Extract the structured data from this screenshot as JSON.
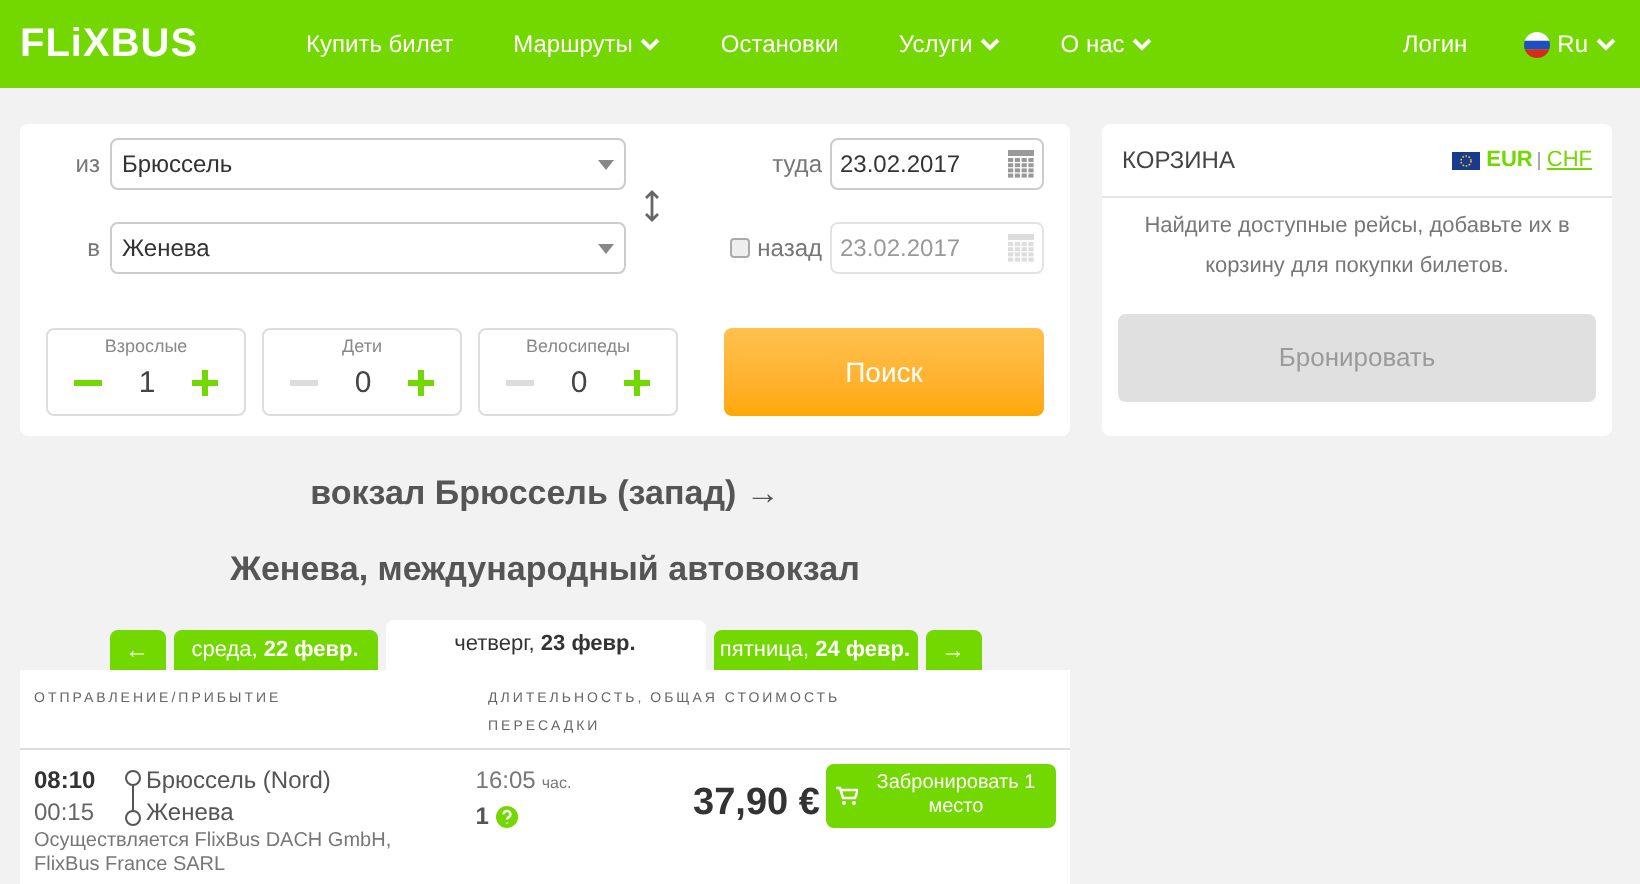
{
  "header": {
    "logo": "FLiXBUS",
    "nav": [
      {
        "label": "Купить билет",
        "dropdown": false
      },
      {
        "label": "Маршруты",
        "dropdown": true
      },
      {
        "label": "Остановки",
        "dropdown": false
      },
      {
        "label": "Услуги",
        "dropdown": true
      },
      {
        "label": "О нас",
        "dropdown": true
      }
    ],
    "login": "Логин",
    "language": "Ru"
  },
  "search": {
    "from": {
      "label": "из",
      "value": "Брюссель"
    },
    "to": {
      "label": "в",
      "value": "Женева"
    },
    "outbound": {
      "label": "туда",
      "value": "23.02.2017"
    },
    "return": {
      "label": "назад",
      "checked": false,
      "value": "23.02.2017"
    },
    "passengers": [
      {
        "label": "Взрослые",
        "value": "1",
        "decrement_disabled": false
      },
      {
        "label": "Дети",
        "value": "0",
        "decrement_disabled": true
      },
      {
        "label": "Велосипеды",
        "value": "0",
        "decrement_disabled": true
      }
    ],
    "button": "Поиск"
  },
  "cart": {
    "title": "КОРЗИНА",
    "currencies": [
      {
        "label": "EUR",
        "selected": true
      },
      {
        "label": "CHF",
        "selected": false
      }
    ],
    "message": "Найдите доступные рейсы, добавьте их в корзину для покупки билетов.",
    "button": "Бронировать",
    "button_disabled": true
  },
  "route_title": [
    "вокзал Брюссель (запад) →",
    "Женева, международный автовокзал"
  ],
  "date_tabs": {
    "prev": "←",
    "next": "→",
    "days": [
      {
        "weekday": "среда,",
        "date": "22 февр.",
        "selected": false
      },
      {
        "weekday": "четверг,",
        "date": "23 февр.",
        "selected": true
      },
      {
        "weekday": "пятница,",
        "date": "24 февр.",
        "selected": false
      }
    ]
  },
  "table": {
    "columns": [
      "ОТПРАВЛЕНИЕ/ПРИБЫТИЕ",
      "ДЛИТЕЛЬНОСТЬ,",
      "ОБЩАЯ СТОИМОСТЬ",
      "ПЕРЕСАДКИ"
    ],
    "rows": [
      {
        "departure": "08:10",
        "arrival": "00:15",
        "from": "Брюссель (Nord)",
        "to": "Женева",
        "operator": "Осуществляется FlixBus DACH GmbH, FlixBus France SARL",
        "duration": "16:05",
        "duration_unit": "час.",
        "transfers": "1",
        "price": "37,90 €",
        "book": "Забронировать 1 место"
      }
    ]
  }
}
